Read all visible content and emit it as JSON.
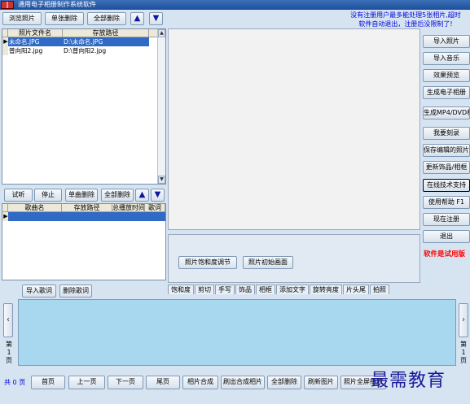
{
  "window": {
    "title": "通用电子相册制作系统软件"
  },
  "top_toolbar": {
    "browse_photos": "浏览照片",
    "delete_single": "单张删除",
    "delete_all": "全部删除",
    "move_up_icon": "up-arrow-icon",
    "move_down_icon": "down-arrow-icon"
  },
  "notice": {
    "line1": "没有注册用户最多能处理5张相片,超时",
    "line2": "软件自动退出，注册后没限制了!"
  },
  "photo_list": {
    "columns": [
      "照片文件名",
      "存放路径"
    ],
    "rows": [
      {
        "name": "未命名.JPG",
        "path": "D:\\未命名.JPG",
        "selected": true
      },
      {
        "name": "普向阳2.jpg",
        "path": "D:\\普向阳2.jpg",
        "selected": false
      }
    ]
  },
  "music_toolbar": {
    "listen": "试听",
    "stop": "停止",
    "delete_single": "单曲删除",
    "delete_all": "全部删除"
  },
  "music_list": {
    "columns": [
      "歌曲名",
      "存放路径",
      "总播放时间",
      "歌词"
    ]
  },
  "lyrics": {
    "import": "导入歌词",
    "delete": "删除歌词"
  },
  "adjust_panel": {
    "saturation": "照片饱和度调节",
    "initial": "照片初始画面"
  },
  "tabs": [
    "饱和度",
    "剪切",
    "手写",
    "饰品",
    "相框",
    "添加文字",
    "旋转亮度",
    "片头尾",
    "拍照"
  ],
  "side_buttons": [
    "导入照片",
    "导入音乐",
    "效果预览",
    "生成电子相册",
    "生成MP4/DVD相册",
    "我要刻录",
    "保存编辑的照片",
    "更新饰品/相框",
    "在线技术支持",
    "使用帮助  F1",
    "现在注册",
    "退出"
  ],
  "trial_text": "软件是试用版",
  "thumb_strip": {
    "left_page_label": "第\n1\n页",
    "right_page_label": "第\n1\n页"
  },
  "bottom_bar": {
    "total_prefix": "共",
    "total_pages": "0",
    "total_suffix": "页",
    "first": "首页",
    "prev": "上一页",
    "next": "下一页",
    "last": "尾页",
    "compose": "相片合成",
    "refresh_compose": "刷出合成相片",
    "delete_all": "全部删除",
    "refresh_pics": "刷新图片",
    "fullscreen": "照片全屏播放"
  },
  "watermark": "最需教育",
  "colors": {
    "background": "#d6e4f2",
    "titlebar": "#1c4f9c",
    "selection": "#316ac5",
    "notice": "#0000d8",
    "trial": "#ff0000",
    "thumb_strip": "#a8d8ef"
  }
}
